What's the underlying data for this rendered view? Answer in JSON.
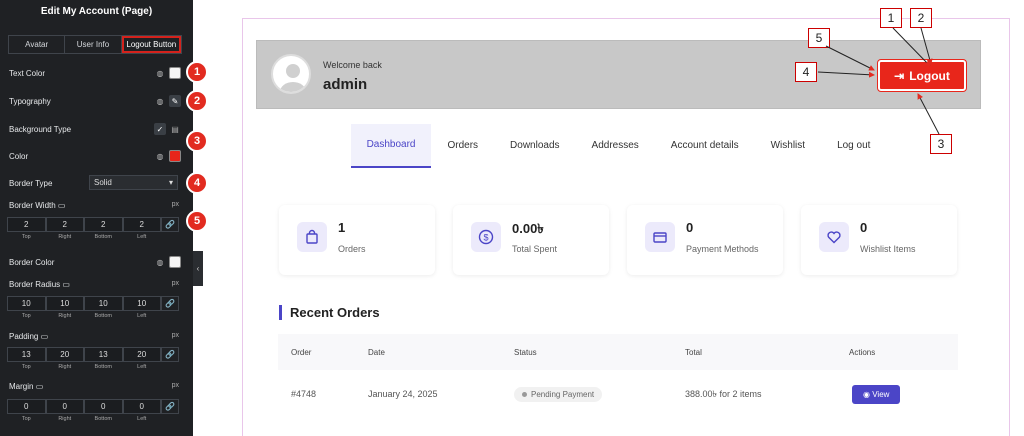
{
  "panel": {
    "title": "Edit My Account (Page)",
    "tabs": [
      "Avatar",
      "User Info",
      "Logout Button"
    ],
    "text_color": "Text Color",
    "typography": "Typography",
    "background_type": "Background Type",
    "color": "Color",
    "border_type": "Border Type",
    "border_type_value": "Solid",
    "border_width": "Border Width",
    "border_color": "Border Color",
    "border_radius": "Border Radius",
    "padding": "Padding",
    "margin": "Margin",
    "unit": "px",
    "border_width_values": [
      "2",
      "2",
      "2",
      "2"
    ],
    "border_radius_values": [
      "10",
      "10",
      "10",
      "10"
    ],
    "padding_values": [
      "13",
      "20",
      "13",
      "20"
    ],
    "margin_values": [
      "0",
      "0",
      "0",
      "0"
    ],
    "sub_labels": [
      "Top",
      "Right",
      "Bottom",
      "Left"
    ],
    "markers": [
      "1",
      "2",
      "3",
      "4",
      "5"
    ]
  },
  "header": {
    "welcome": "Welcome back",
    "username": "admin",
    "logout_label": "Logout"
  },
  "nav": [
    "Dashboard",
    "Orders",
    "Downloads",
    "Addresses",
    "Account details",
    "Wishlist",
    "Log out"
  ],
  "cards": [
    {
      "value": "1",
      "label": "Orders"
    },
    {
      "value": "0.00৳",
      "label": "Total Spent"
    },
    {
      "value": "0",
      "label": "Payment Methods"
    },
    {
      "value": "0",
      "label": "Wishlist Items"
    }
  ],
  "recent": {
    "title": "Recent Orders",
    "columns": [
      "Order",
      "Date",
      "Status",
      "Total",
      "Actions"
    ],
    "row": {
      "order": "#4748",
      "date": "January 24, 2025",
      "status": "Pending Payment",
      "total": "388.00৳  for 2 items",
      "action": "View"
    }
  },
  "annotations": [
    "1",
    "2",
    "3",
    "4",
    "5"
  ],
  "colors": {
    "accent": "#4b45c7",
    "logout": "#e8261b",
    "marker": "#e22b20"
  }
}
